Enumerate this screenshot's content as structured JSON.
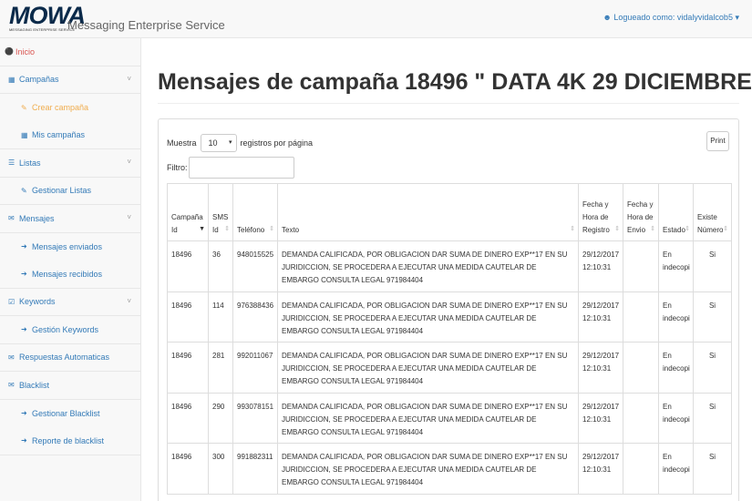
{
  "navbar": {
    "logo_text": "MOWA",
    "logo_subtext": "MESSAGING ENTERPRISE SERVICE",
    "brand": "Messaging Enterprise Service",
    "user_label": "Logueado como: vidalyvidalcob5",
    "user_icon": "user-icon",
    "caret": "▾"
  },
  "sidebar": {
    "items": [
      {
        "label": "Inicio",
        "icon": "home-icon"
      },
      {
        "label": "Campañas",
        "icon": "table-icon",
        "chevron": "˅"
      },
      {
        "label": "Crear campaña",
        "icon": "edit-icon"
      },
      {
        "label": "Mis campañas",
        "icon": "table-icon"
      },
      {
        "label": "Listas",
        "icon": "list-icon",
        "chevron": "˅"
      },
      {
        "label": "Gestionar Listas",
        "icon": "edit-icon"
      },
      {
        "label": "Mensajes",
        "icon": "envelope-icon",
        "chevron": "˅"
      },
      {
        "label": "Mensajes enviados",
        "icon": "sign-out-icon"
      },
      {
        "label": "Mensajes recibidos",
        "icon": "sign-in-icon"
      },
      {
        "label": "Keywords",
        "icon": "check-square-icon",
        "chevron": "˅"
      },
      {
        "label": "Gestión Keywords",
        "icon": "sign-out-icon"
      },
      {
        "label": "Respuestas Automaticas",
        "icon": "envelope-icon"
      },
      {
        "label": "Blacklist",
        "icon": "envelope-icon"
      },
      {
        "label": "Gestionar Blacklist",
        "icon": "sign-out-icon"
      },
      {
        "label": "Reporte de blacklist",
        "icon": "sign-out-icon"
      }
    ]
  },
  "main": {
    "title": "Mensajes de campaña 18496 \" DATA 4K 29 DICIEMBRE \"",
    "length_prefix": "Muestra",
    "length_value": "10",
    "length_suffix": "registros por página",
    "filter_label": "Filtro:",
    "filter_value": "",
    "print_label": "Print"
  },
  "table": {
    "headers": [
      "Campaña Id",
      "SMS Id",
      "Teléfono",
      "Texto",
      "Fecha y Hora de Registro",
      "Fecha y Hora de Envio",
      "Estado",
      "Existe Número"
    ],
    "rows": [
      [
        "18496",
        "36",
        "948015525",
        "DEMANDA CALIFICADA, POR OBLIGACION DAR SUMA DE DINERO EXP**17 EN SU JURIDICCION, SE PROCEDERA A EJECUTAR UNA MEDIDA CAUTELAR DE EMBARGO CONSULTA LEGAL 971984404",
        "29/12/2017 12:10:31",
        "",
        "En indecopi",
        "Si"
      ],
      [
        "18496",
        "114",
        "976388436",
        "DEMANDA CALIFICADA, POR OBLIGACION DAR SUMA DE DINERO EXP**17 EN SU JURIDICCION, SE PROCEDERA A EJECUTAR UNA MEDIDA CAUTELAR DE EMBARGO CONSULTA LEGAL 971984404",
        "29/12/2017 12:10:31",
        "",
        "En indecopi",
        "Si"
      ],
      [
        "18496",
        "281",
        "992011067",
        "DEMANDA CALIFICADA, POR OBLIGACION DAR SUMA DE DINERO EXP**17 EN SU JURIDICCION, SE PROCEDERA A EJECUTAR UNA MEDIDA CAUTELAR DE EMBARGO CONSULTA LEGAL 971984404",
        "29/12/2017 12:10:31",
        "",
        "En indecopi",
        "Si"
      ],
      [
        "18496",
        "290",
        "993078151",
        "DEMANDA CALIFICADA, POR OBLIGACION DAR SUMA DE DINERO EXP**17 EN SU JURIDICCION, SE PROCEDERA A EJECUTAR UNA MEDIDA CAUTELAR DE EMBARGO CONSULTA LEGAL 971984404",
        "29/12/2017 12:10:31",
        "",
        "En indecopi",
        "Si"
      ],
      [
        "18496",
        "300",
        "991882311",
        "DEMANDA CALIFICADA, POR OBLIGACION DAR SUMA DE DINERO EXP**17 EN SU JURIDICCION, SE PROCEDERA A EJECUTAR UNA MEDIDA CAUTELAR DE EMBARGO CONSULTA LEGAL 971984404",
        "29/12/2017 12:10:31",
        "",
        "En indecopi",
        "Si"
      ]
    ]
  },
  "colors": {
    "link": "#337ab7",
    "active": "#f0ad4e",
    "home": "#d9534f",
    "logo": "#0b2a4a"
  }
}
